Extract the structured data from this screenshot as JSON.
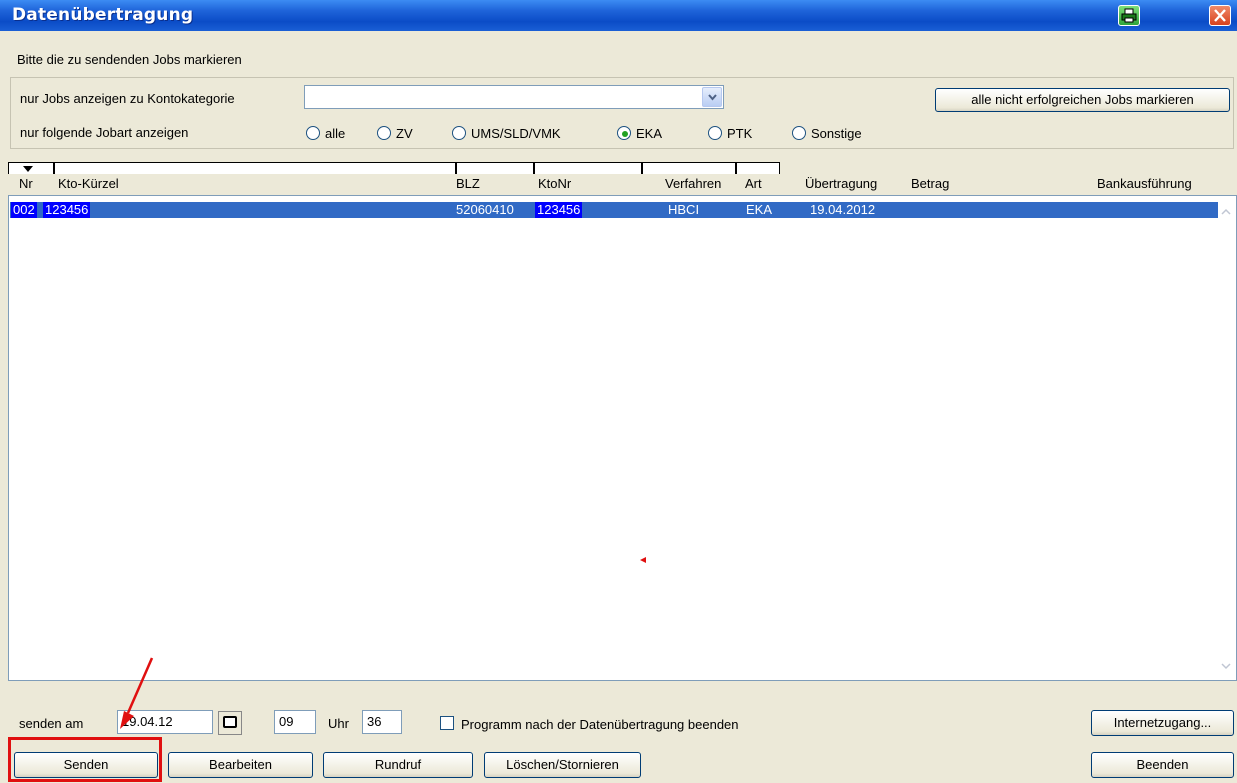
{
  "window": {
    "title": "Datenübertragung",
    "instruction": "Bitte die zu sendenden Jobs markieren"
  },
  "filters": {
    "kontokategorie_label": "nur Jobs anzeigen zu Kontokategorie",
    "kontokategorie_value": "",
    "jobart_label": "nur folgende Jobart anzeigen",
    "mark_failed_button": "alle nicht erfolgreichen Jobs markieren",
    "radios": [
      {
        "label": "alle",
        "selected": false
      },
      {
        "label": "ZV",
        "selected": false
      },
      {
        "label": "UMS/SLD/VMK",
        "selected": false
      },
      {
        "label": "EKA",
        "selected": true
      },
      {
        "label": "PTK",
        "selected": false
      },
      {
        "label": "Sonstige",
        "selected": false
      }
    ]
  },
  "table": {
    "columns": [
      "Nr",
      "Kto-Kürzel",
      "BLZ",
      "KtoNr",
      "Verfahren",
      "Art",
      "Übertragung",
      "Betrag",
      "Bankausführung"
    ],
    "rows": [
      {
        "nr": "002",
        "kto": "123456",
        "blz": "52060410",
        "ktonr": "123456",
        "verfahren": "HBCI",
        "art": "EKA",
        "uebertragung": "19.04.2012",
        "betrag": "",
        "bankausfuehrung": ""
      }
    ]
  },
  "schedule": {
    "senden_am_label": "senden am",
    "date": "19.04.12",
    "hour": "09",
    "uhr_label": "Uhr",
    "minute": "36",
    "exit_after_label": "Programm nach der Datenübertragung beenden"
  },
  "buttons": {
    "internet": "Internetzugang...",
    "senden": "Senden",
    "bearbeiten": "Bearbeiten",
    "rundruf": "Rundruf",
    "loeschen": "Löschen/Stornieren",
    "beenden": "Beenden"
  },
  "colors": {
    "titlebar": "#0b4cc7",
    "selection": "#316ac5",
    "highlight": "#0000ff",
    "annotation": "#e01010"
  }
}
